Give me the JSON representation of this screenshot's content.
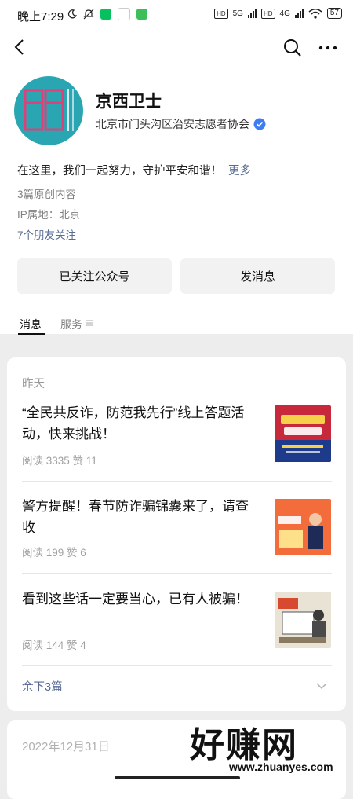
{
  "status_bar": {
    "time": "晚上7:29",
    "battery": "57",
    "hd1": "HD",
    "hd2": "HD",
    "net1": "5G",
    "net2": "4G"
  },
  "account": {
    "name": "京西卫士",
    "org": "北京市门头沟区治安志愿者协会",
    "description": "在这里，我们一起努力，守护平安和谐！",
    "more_link": "更多",
    "original_count": "3篇原创内容",
    "ip_location": "IP属地：北京",
    "friends_following": "7个朋友关注"
  },
  "buttons": {
    "followed": "已关注公众号",
    "message": "发消息"
  },
  "tabs": [
    {
      "label": "消息"
    },
    {
      "label": "服务"
    }
  ],
  "feed": {
    "date_group": "昨天",
    "articles": [
      {
        "title": "“全民共反诈，防范我先行”线上答题活动，快来挑战！",
        "stats": "阅读 3335   赞 11"
      },
      {
        "title": "警方提醒！春节防诈骗锦囊来了，请查收",
        "stats": "阅读 199   赞 6"
      },
      {
        "title": "看到这些话一定要当心，已有人被骗！",
        "stats": "阅读 144   赞 4"
      }
    ],
    "remaining": "余下3篇",
    "next_date_group": "2022年12月31日"
  },
  "watermark": {
    "text": "好赚网",
    "url": "www.zhuanyes.com"
  },
  "colors": {
    "link": "#576b95",
    "verified": "#3d7cf5",
    "avatar_bg": "#2aa6b3"
  }
}
